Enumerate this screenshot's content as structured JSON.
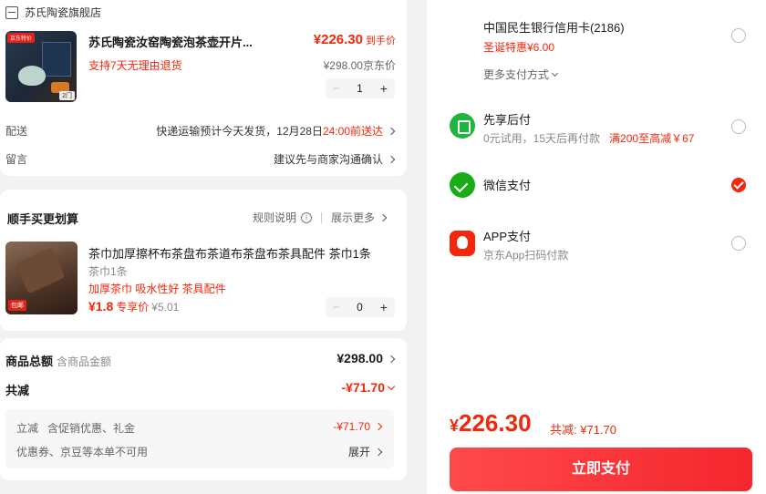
{
  "shop": {
    "name": "苏氏陶瓷旗舰店"
  },
  "product": {
    "tag": "京东特价",
    "qty_badge": "2门",
    "title": "苏氏陶瓷汝窑陶瓷泡茶壶开片...",
    "price": "¥226.30",
    "price_label": "到手价",
    "return_policy": "支持7天无理由退货",
    "orig_price": "¥298.00",
    "orig_label": "京东价",
    "quantity": "1",
    "minus": "−",
    "plus": "+"
  },
  "delivery": {
    "label": "配送",
    "text": "快递运输预计今天发货，12月28日",
    "highlight": "24:00前送达"
  },
  "message": {
    "label": "留言",
    "text": "建议先与商家沟通确认"
  },
  "bundle": {
    "title": "顺手买更划算",
    "rules": "规则说明",
    "info": "i",
    "more": "展示更多",
    "item": {
      "tag": "包邮",
      "name": "茶巾加厚擦杯布茶盘布茶道布茶盘布茶具配件 茶巾1条",
      "spec": "茶巾1条",
      "tags": "加厚茶巾 吸水性好 茶具配件",
      "price": "¥1.8",
      "price_label": "专享价",
      "orig_price": "¥5.01",
      "quantity": "0",
      "minus": "−",
      "plus": "+"
    }
  },
  "totals": {
    "goods_label": "商品总额",
    "goods_sub": "含商品金额",
    "goods_value": "¥298.00",
    "discount_label": "共减",
    "discount_value": "-¥71.70",
    "instant_label": "立减",
    "instant_sub": "含促销优惠、礼金",
    "instant_value": "-¥71.70",
    "coupon_note": "优惠券、京豆等本单不可用",
    "expand": "展开"
  },
  "payments": [
    {
      "name": "中国民生银行信用卡(2186)",
      "sub": "",
      "sub_red": "圣诞特惠¥6.00",
      "selected": false
    },
    {
      "name": "先享后付",
      "sub": "0元试用，15天后再付款",
      "sub_red": "满200至高减￥67",
      "selected": false
    },
    {
      "name": "微信支付",
      "sub": "",
      "sub_red": "",
      "selected": true
    },
    {
      "name": "APP支付",
      "sub": "京东App扫码付款",
      "sub_red": "",
      "selected": false
    }
  ],
  "more_payments": "更多支付方式",
  "checkout": {
    "currency": "¥",
    "amount": "226.30",
    "saving": "共减: ¥71.70",
    "button": "立即支付"
  },
  "colors": {
    "accent": "#f2270c",
    "wechat": "#1aad19"
  }
}
